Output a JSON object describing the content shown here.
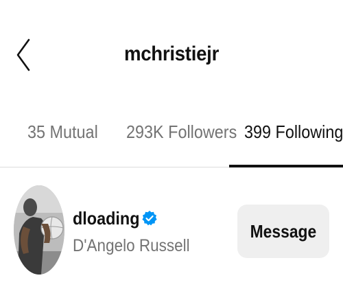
{
  "header": {
    "title": "mchristiejr",
    "back_icon": "chevron-left-icon"
  },
  "tabs": [
    {
      "label": "35 Mutual",
      "active": false
    },
    {
      "label": "293K Followers",
      "active": false
    },
    {
      "label": "399 Following",
      "active": true
    }
  ],
  "user": {
    "username": "dloading",
    "full_name": "D'Angelo Russell",
    "verified": true,
    "verified_icon": "verified-badge-icon",
    "avatar_icon": "avatar-photo",
    "action_label": "Message"
  },
  "colors": {
    "text_primary": "#111111",
    "text_secondary": "#737373",
    "verified_blue": "#0095f6",
    "button_bg": "#efefef",
    "divider": "#dbdbdb"
  }
}
